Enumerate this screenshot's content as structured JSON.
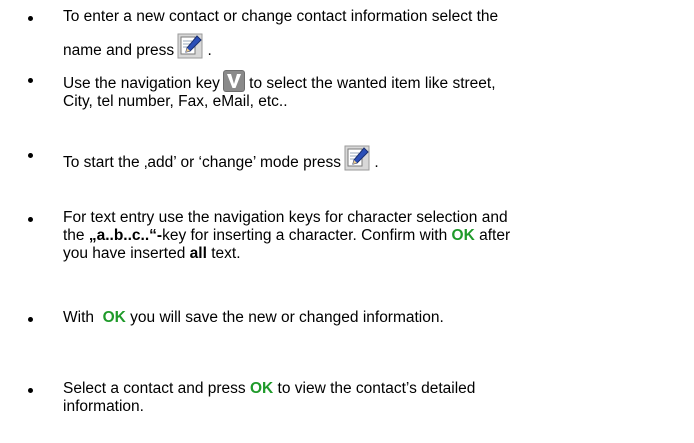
{
  "items": [
    {
      "line1": "To enter a new contact or change contact information select the",
      "line2": "name and press",
      "after_icon": " ."
    },
    {
      "before_icon": "Use the navigation key",
      "after_icon": " to select the wanted item like street,",
      "line2": "City, tel number, Fax, eMail, etc.."
    },
    {
      "before_icon": "To start the ‚add’ or ‘change’ mode press",
      "after_icon": " ."
    },
    {
      "line1": "For text entry use the navigation keys for character selection and",
      "line2_a": "the  ",
      "line2_key": "„a..b..c..“-",
      "line2_b": "key for inserting a character. Confirm with ",
      "line2_ok": "OK",
      "line2_c": " after",
      "line3_a": "you have inserted ",
      "line3_all": "all",
      "line3_b": " text."
    },
    {
      "a": "With  ",
      "ok": "OK",
      "b": " you will save the new or changed information."
    },
    {
      "a": "Select a contact and press ",
      "ok": "OK",
      "b": " to view the contact’s detailed",
      "line2": "information."
    }
  ],
  "icons": {
    "edit": "edit-pen-icon",
    "nav": "navigation-key-v-icon"
  },
  "colors": {
    "ok_green": "#1f9a2a"
  }
}
